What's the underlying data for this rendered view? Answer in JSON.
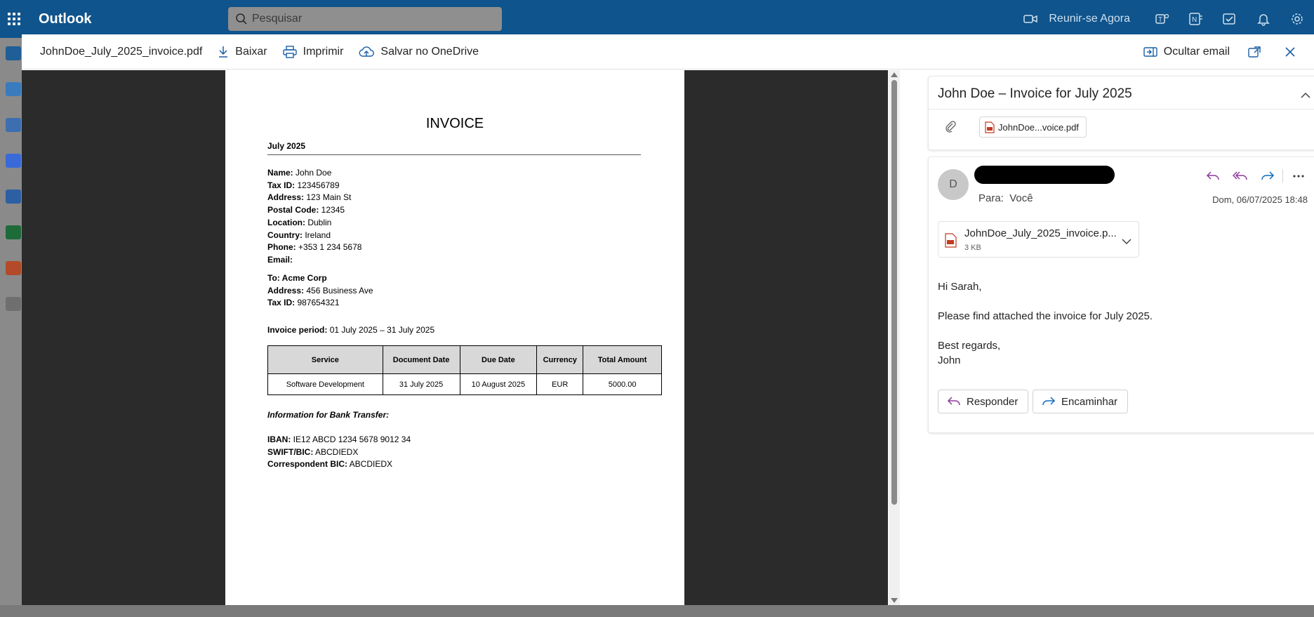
{
  "app": {
    "brand": "Outlook"
  },
  "search": {
    "placeholder": "Pesquisar"
  },
  "topbar": {
    "meet_label": "Reunir-se Agora"
  },
  "viewer_toolbar": {
    "filename": "JohnDoe_July_2025_invoice.pdf",
    "download": "Baixar",
    "print": "Imprimir",
    "save_onedrive": "Salvar no OneDrive",
    "hide_email": "Ocultar email"
  },
  "invoice": {
    "title": "INVOICE",
    "month": "July 2025",
    "sender": [
      {
        "label": "Name:",
        "value": " John Doe"
      },
      {
        "label": "Tax ID:",
        "value": " 123456789"
      },
      {
        "label": "Address:",
        "value": " 123 Main St"
      },
      {
        "label": "Postal Code:",
        "value": " 12345"
      },
      {
        "label": "Location:",
        "value": " Dublin"
      },
      {
        "label": "Country:",
        "value": " Ireland"
      },
      {
        "label": "Phone:",
        "value": " +353 1 234 5678"
      },
      {
        "label": "Email:",
        "value": ""
      }
    ],
    "recipient": [
      {
        "label": "To: Acme Corp",
        "value": ""
      },
      {
        "label": "Address:",
        "value": " 456 Business Ave"
      },
      {
        "label": "Tax ID:",
        "value": " 987654321"
      }
    ],
    "period_label": "Invoice period:",
    "period_value": " 01 July 2025 – 31 July 2025",
    "table": {
      "headers": [
        "Service",
        "Document Date",
        "Due Date",
        "Currency",
        "Total Amount"
      ],
      "rows": [
        [
          "Software Development",
          "31 July 2025",
          "10 August 2025",
          "EUR",
          "5000.00"
        ]
      ]
    },
    "bank_title": "Information for Bank Transfer:",
    "bank": [
      {
        "label": "IBAN:",
        "value": " IE12 ABCD 1234 5678 9012 34"
      },
      {
        "label": "SWIFT/BIC:",
        "value": " ABCDIEDX"
      },
      {
        "label": "Correspondent BIC:",
        "value": " ABCDIEDX"
      }
    ]
  },
  "email": {
    "subject": "John Doe – Invoice for July 2025",
    "attachment_chip": "JohnDoe...voice.pdf",
    "avatar_initial": "D",
    "to_label": "Para:",
    "to_value": "Você",
    "date": "Dom, 06/07/2025 18:48",
    "attachment_name": "JohnDoe_July_2025_invoice.p...",
    "attachment_size": "3 KB",
    "body": [
      "Hi Sarah,",
      "Please find attached the invoice for July 2025.",
      "Best regards,",
      "John"
    ],
    "reply_button": "Responder",
    "forward_button": "Encaminhar"
  },
  "colors": {
    "topbar": "#0f548c",
    "accent_purple": "#8e3a9d",
    "accent_blue": "#0f6cbd",
    "viewer_bg": "#2b2b2b"
  }
}
